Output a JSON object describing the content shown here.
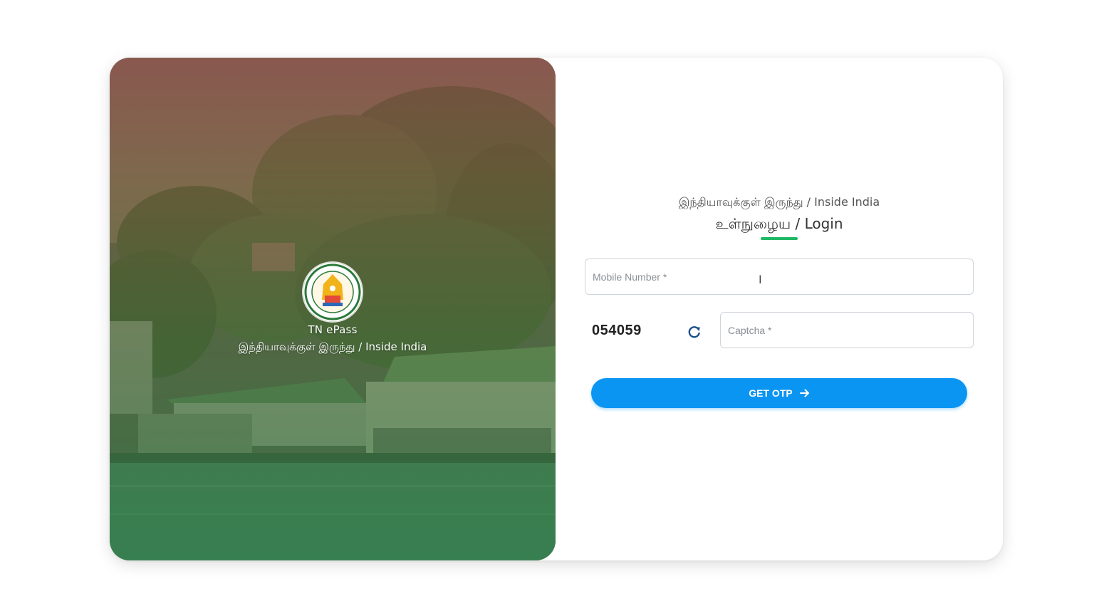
{
  "brand": {
    "app_name": "TN ePass",
    "subtitle": "இந்தியாவுக்குள் இருந்து / Inside India"
  },
  "login_form": {
    "heading": "இந்தியாவுக்குள் இருந்து / Inside India",
    "title": "உள்நுழைய / Login",
    "mobile_placeholder": "Mobile Number *",
    "mobile_value": "",
    "captcha_code": "054059",
    "captcha_placeholder": "Captcha *",
    "captcha_value": "",
    "submit_label": "GET OTP"
  },
  "icons": {
    "refresh": "refresh-icon",
    "submit_arrow": "arrow-right-icon",
    "emblem": "state-emblem-icon"
  },
  "colors": {
    "accent": "#0b95f3",
    "underline": "#1fb864"
  }
}
